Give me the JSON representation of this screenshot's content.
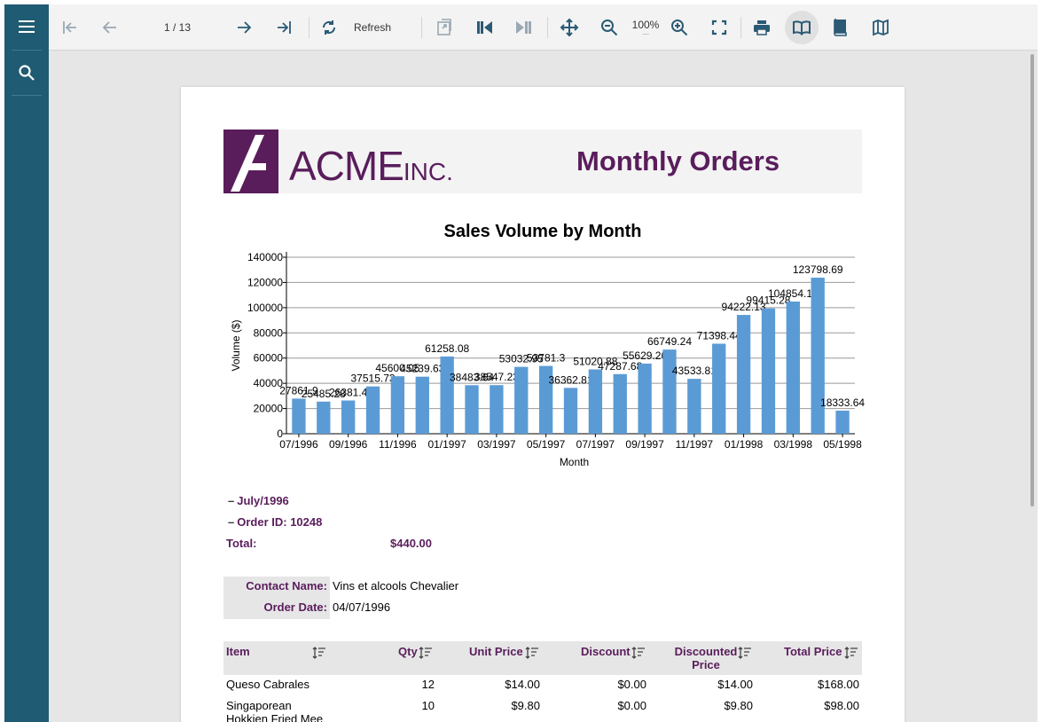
{
  "toolbar": {
    "page_indicator": "1 / 13",
    "refresh_label": "Refresh",
    "zoom_label": "100%",
    "zoom_dots": "...."
  },
  "report": {
    "logo_text": "ACME",
    "logo_suffix": "INC.",
    "title": "Monthly Orders"
  },
  "chart_data": {
    "type": "bar",
    "title": "Sales Volume by Month",
    "xlabel": "Month",
    "ylabel": "Volume ($)",
    "ylim": [
      0,
      140000
    ],
    "yticks": [
      0,
      20000,
      40000,
      60000,
      80000,
      100000,
      120000,
      140000
    ],
    "categories": [
      "07/1996",
      "08/1996",
      "09/1996",
      "10/1996",
      "11/1996",
      "12/1996",
      "01/1997",
      "02/1997",
      "03/1997",
      "04/1997",
      "05/1997",
      "06/1997",
      "07/1997",
      "08/1997",
      "09/1997",
      "10/1997",
      "11/1997",
      "12/1997",
      "01/1998",
      "02/1998",
      "03/1998",
      "04/1998",
      "05/1998"
    ],
    "tick_labels": [
      "07/1996",
      "09/1996",
      "11/1996",
      "01/1997",
      "03/1997",
      "05/1997",
      "07/1997",
      "09/1997",
      "11/1997",
      "01/1998",
      "03/1998",
      "05/1998"
    ],
    "values": [
      27861.9,
      25485.28,
      26381.4,
      37515.73,
      45600.05,
      45239.63,
      61258.08,
      38483.64,
      38547.23,
      53032.95,
      53781.3,
      36362.81,
      51020.88,
      47287.68,
      55629.26,
      66749.24,
      43533.81,
      71398.44,
      94222.13,
      99415.28,
      104854.18,
      123798.69,
      18333.64
    ],
    "data_labels": [
      "27861.9",
      "25485.28",
      "26381.4",
      "37515.73",
      "45600.05",
      "45239.63",
      "61258.08",
      "38483.64",
      "38547.23",
      "53032.95",
      "53781.3",
      "36362.81",
      "51020.88",
      "47287.68",
      "55629.26",
      "66749.24",
      "43533.81",
      "71398.44",
      "94222.13",
      "99415.28",
      "104854.18",
      "123798.69",
      "18333.64"
    ],
    "bar_color": "#5b9bd5",
    "grid": true,
    "legend": "none"
  },
  "groups": {
    "month": "July/1996",
    "order": "Order ID: 10248",
    "total_label": "Total:",
    "total_value": "$440.00"
  },
  "info": {
    "contact_label": "Contact Name:",
    "contact_value": "Vins et alcools Chevalier",
    "date_label": "Order Date:",
    "date_value": "04/07/1996"
  },
  "table": {
    "headers": {
      "item": "Item",
      "qty": "Qty",
      "unit_price": "Unit Price",
      "discount": "Discount",
      "discounted_line1": "Discounted",
      "discounted_line2": "Price",
      "total_price": "Total Price"
    },
    "rows": [
      {
        "item_line1": "Queso Cabrales",
        "item_line2": "",
        "qty": "12",
        "unit_price": "$14.00",
        "discount": "$0.00",
        "discounted": "$14.00",
        "total": "$168.00"
      },
      {
        "item_line1": "Singaporean",
        "item_line2": "Hokkien Fried Mee",
        "qty": "10",
        "unit_price": "$9.80",
        "discount": "$0.00",
        "discounted": "$9.80",
        "total": "$98.00"
      }
    ]
  },
  "colors": {
    "sidebar": "#1f5b72",
    "brand": "#5a1d5c",
    "bar": "#5b9bd5"
  }
}
